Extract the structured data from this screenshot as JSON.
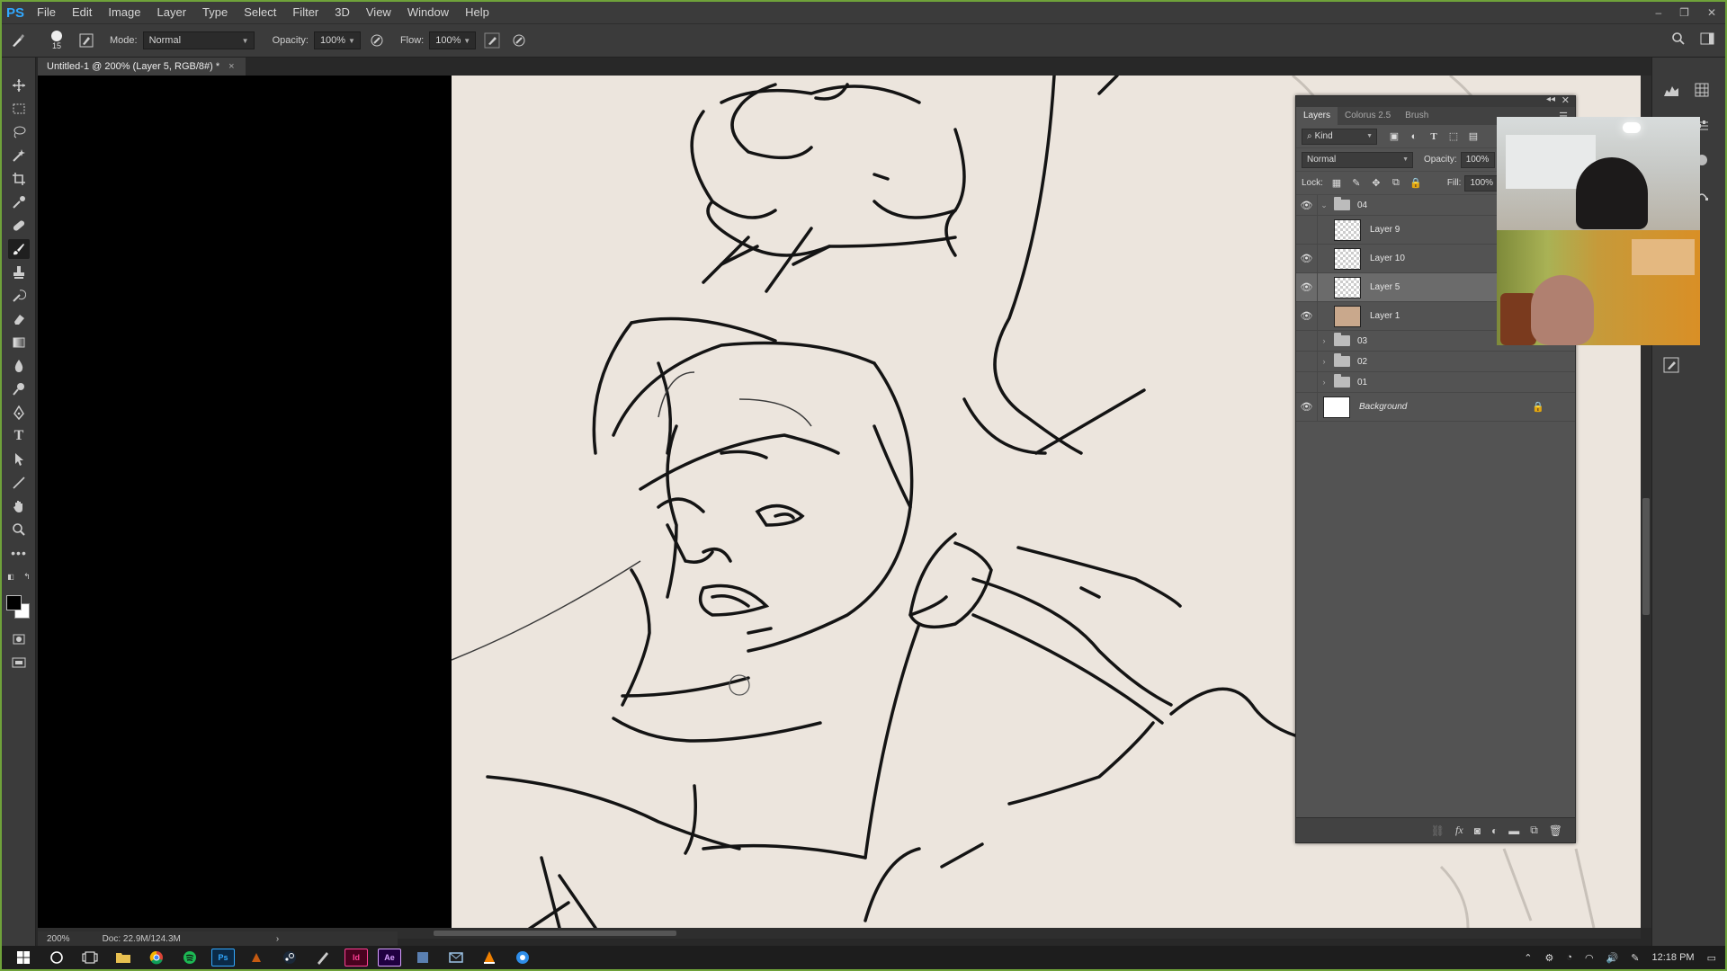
{
  "menubar": {
    "logo": "PS",
    "items": [
      "File",
      "Edit",
      "Image",
      "Layer",
      "Type",
      "Select",
      "Filter",
      "3D",
      "View",
      "Window",
      "Help"
    ],
    "minimize": "‒",
    "restore": "❐",
    "close": "✕"
  },
  "options": {
    "brush_size": "15",
    "mode_label": "Mode:",
    "mode_value": "Normal",
    "opacity_label": "Opacity:",
    "opacity_value": "100%",
    "flow_label": "Flow:",
    "flow_value": "100%"
  },
  "document": {
    "tab_title": "Untitled-1 @ 200% (Layer 5, RGB/8#) *",
    "tab_close": "×"
  },
  "status": {
    "zoom": "200%",
    "doc_size": "Doc: 22.9M/124.3M",
    "arrow": "›"
  },
  "layers_panel": {
    "tabs": [
      "Layers",
      "Colorus 2.5",
      "Brush"
    ],
    "kind_label": "Kind",
    "blend_mode": "Normal",
    "opacity_label": "Opacity:",
    "opacity_value": "100%",
    "lock_label": "Lock:",
    "fill_label": "Fill:",
    "fill_value": "100%",
    "layers": [
      {
        "name": "04",
        "type": "group",
        "visible": true,
        "expanded": true
      },
      {
        "name": "Layer 9",
        "type": "layer",
        "visible": false
      },
      {
        "name": "Layer 10",
        "type": "layer",
        "visible": true
      },
      {
        "name": "Layer 5",
        "type": "layer",
        "visible": true,
        "selected": true
      },
      {
        "name": "Layer 1",
        "type": "layer",
        "visible": true,
        "photo": true
      },
      {
        "name": "03",
        "type": "group",
        "visible": false
      },
      {
        "name": "02",
        "type": "group",
        "visible": false
      },
      {
        "name": "01",
        "type": "group",
        "visible": false
      },
      {
        "name": "Background",
        "type": "background",
        "visible": true,
        "locked": true
      }
    ]
  },
  "taskbar": {
    "clock": "12:18 PM",
    "apps": [
      "start",
      "search",
      "task-view",
      "file-explorer",
      "chrome",
      "spotify",
      "photoshop",
      "app",
      "steam",
      "app",
      "indesign",
      "aftereffects",
      "app",
      "app",
      "vlc",
      "app"
    ]
  },
  "icons": {
    "eye": "👁",
    "lock": "🔒"
  }
}
